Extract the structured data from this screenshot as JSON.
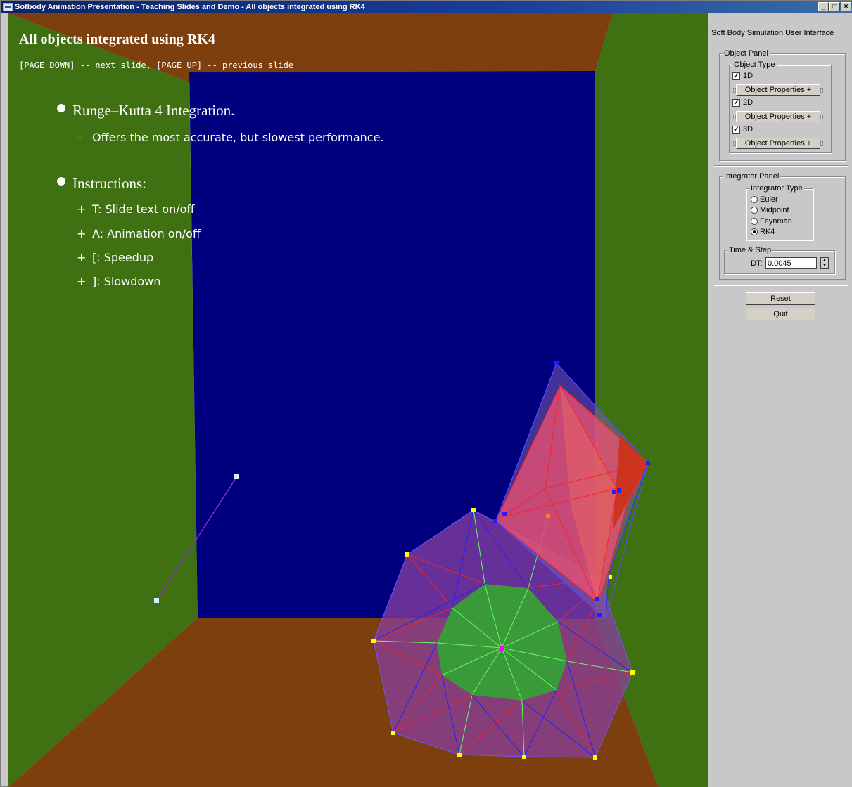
{
  "window": {
    "title": "Sofbody Animation Presentation - Teaching Slides and Demo - All objects integrated using RK4",
    "minimize": "_",
    "maximize": "□",
    "close": "×"
  },
  "slide": {
    "title": "All objects integrated using RK4",
    "nav_hint": "[PAGE DOWN] -- next slide, [PAGE UP] -- previous slide",
    "bullets": [
      {
        "text": "Runge–Kutta 4 Integration.",
        "subs": [
          {
            "mark": "–",
            "text": "Offers the most accurate, but slowest performance."
          }
        ]
      },
      {
        "text": "Instructions:",
        "subs": [
          {
            "mark": "+",
            "text": "T: Slide text on/off"
          },
          {
            "mark": "+",
            "text": "A: Animation on/off"
          },
          {
            "mark": "+",
            "text": "[: Speedup"
          },
          {
            "mark": "+",
            "text": "]: Slowdown"
          }
        ]
      }
    ]
  },
  "panel": {
    "title": "Soft Body Simulation User Interface",
    "object_panel": {
      "label": "Object Panel",
      "object_type_label": "Object Type",
      "items": [
        {
          "label": "1D",
          "checked": true,
          "check_mark": "✓",
          "properties_label": "Object Properties +"
        },
        {
          "label": "2D",
          "checked": true,
          "check_mark": "✓",
          "properties_label": "Object Properties +"
        },
        {
          "label": "3D",
          "checked": true,
          "check_mark": "✓",
          "properties_label": "Object Properties +"
        }
      ]
    },
    "integrator_panel": {
      "label": "Integrator Panel",
      "integrator_type_label": "Integrator Type",
      "options": [
        "Euler",
        "Midpoint",
        "Feynman",
        "RK4"
      ],
      "selected": "RK4",
      "time_step_label": "Time & Step",
      "dt_label": "DT:",
      "dt_value": "0.0045"
    },
    "reset_label": "Reset",
    "quit_label": "Quit"
  },
  "scene_colors": {
    "left_wall": "#3f7012",
    "floor": "#7e3f0f",
    "back_wall": "#00007f",
    "mesh_red": "#ff2020",
    "mesh_blue": "#2020ff",
    "mesh_green": "#60ff60",
    "center_disk": "#3a9a3a",
    "mass_yellow": "#ffff00"
  }
}
